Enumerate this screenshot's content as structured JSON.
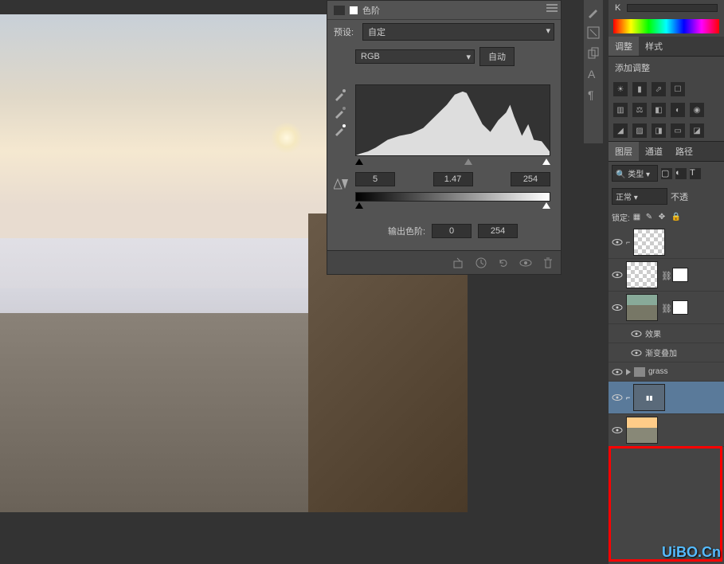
{
  "levels": {
    "title": "色阶",
    "preset_label": "预设:",
    "preset_value": "自定",
    "channel": "RGB",
    "auto_btn": "自动",
    "input_black": "5",
    "input_gamma": "1.47",
    "input_white": "254",
    "output_label": "输出色阶:",
    "output_black": "0",
    "output_white": "254"
  },
  "color": {
    "k_label": "K"
  },
  "tabs": {
    "adjustments": "调整",
    "styles": "样式",
    "layers": "图层",
    "channels": "通道",
    "paths": "路径"
  },
  "adjustments": {
    "add_label": "添加调整"
  },
  "layers": {
    "filter_type": "类型",
    "blend_mode": "正常",
    "opacity_label": "不透",
    "lock_label": "锁定:",
    "effects_label": "效果",
    "gradient_overlay": "渐变叠加",
    "grass_group": "grass"
  },
  "watermark": "UiBO.Cn"
}
